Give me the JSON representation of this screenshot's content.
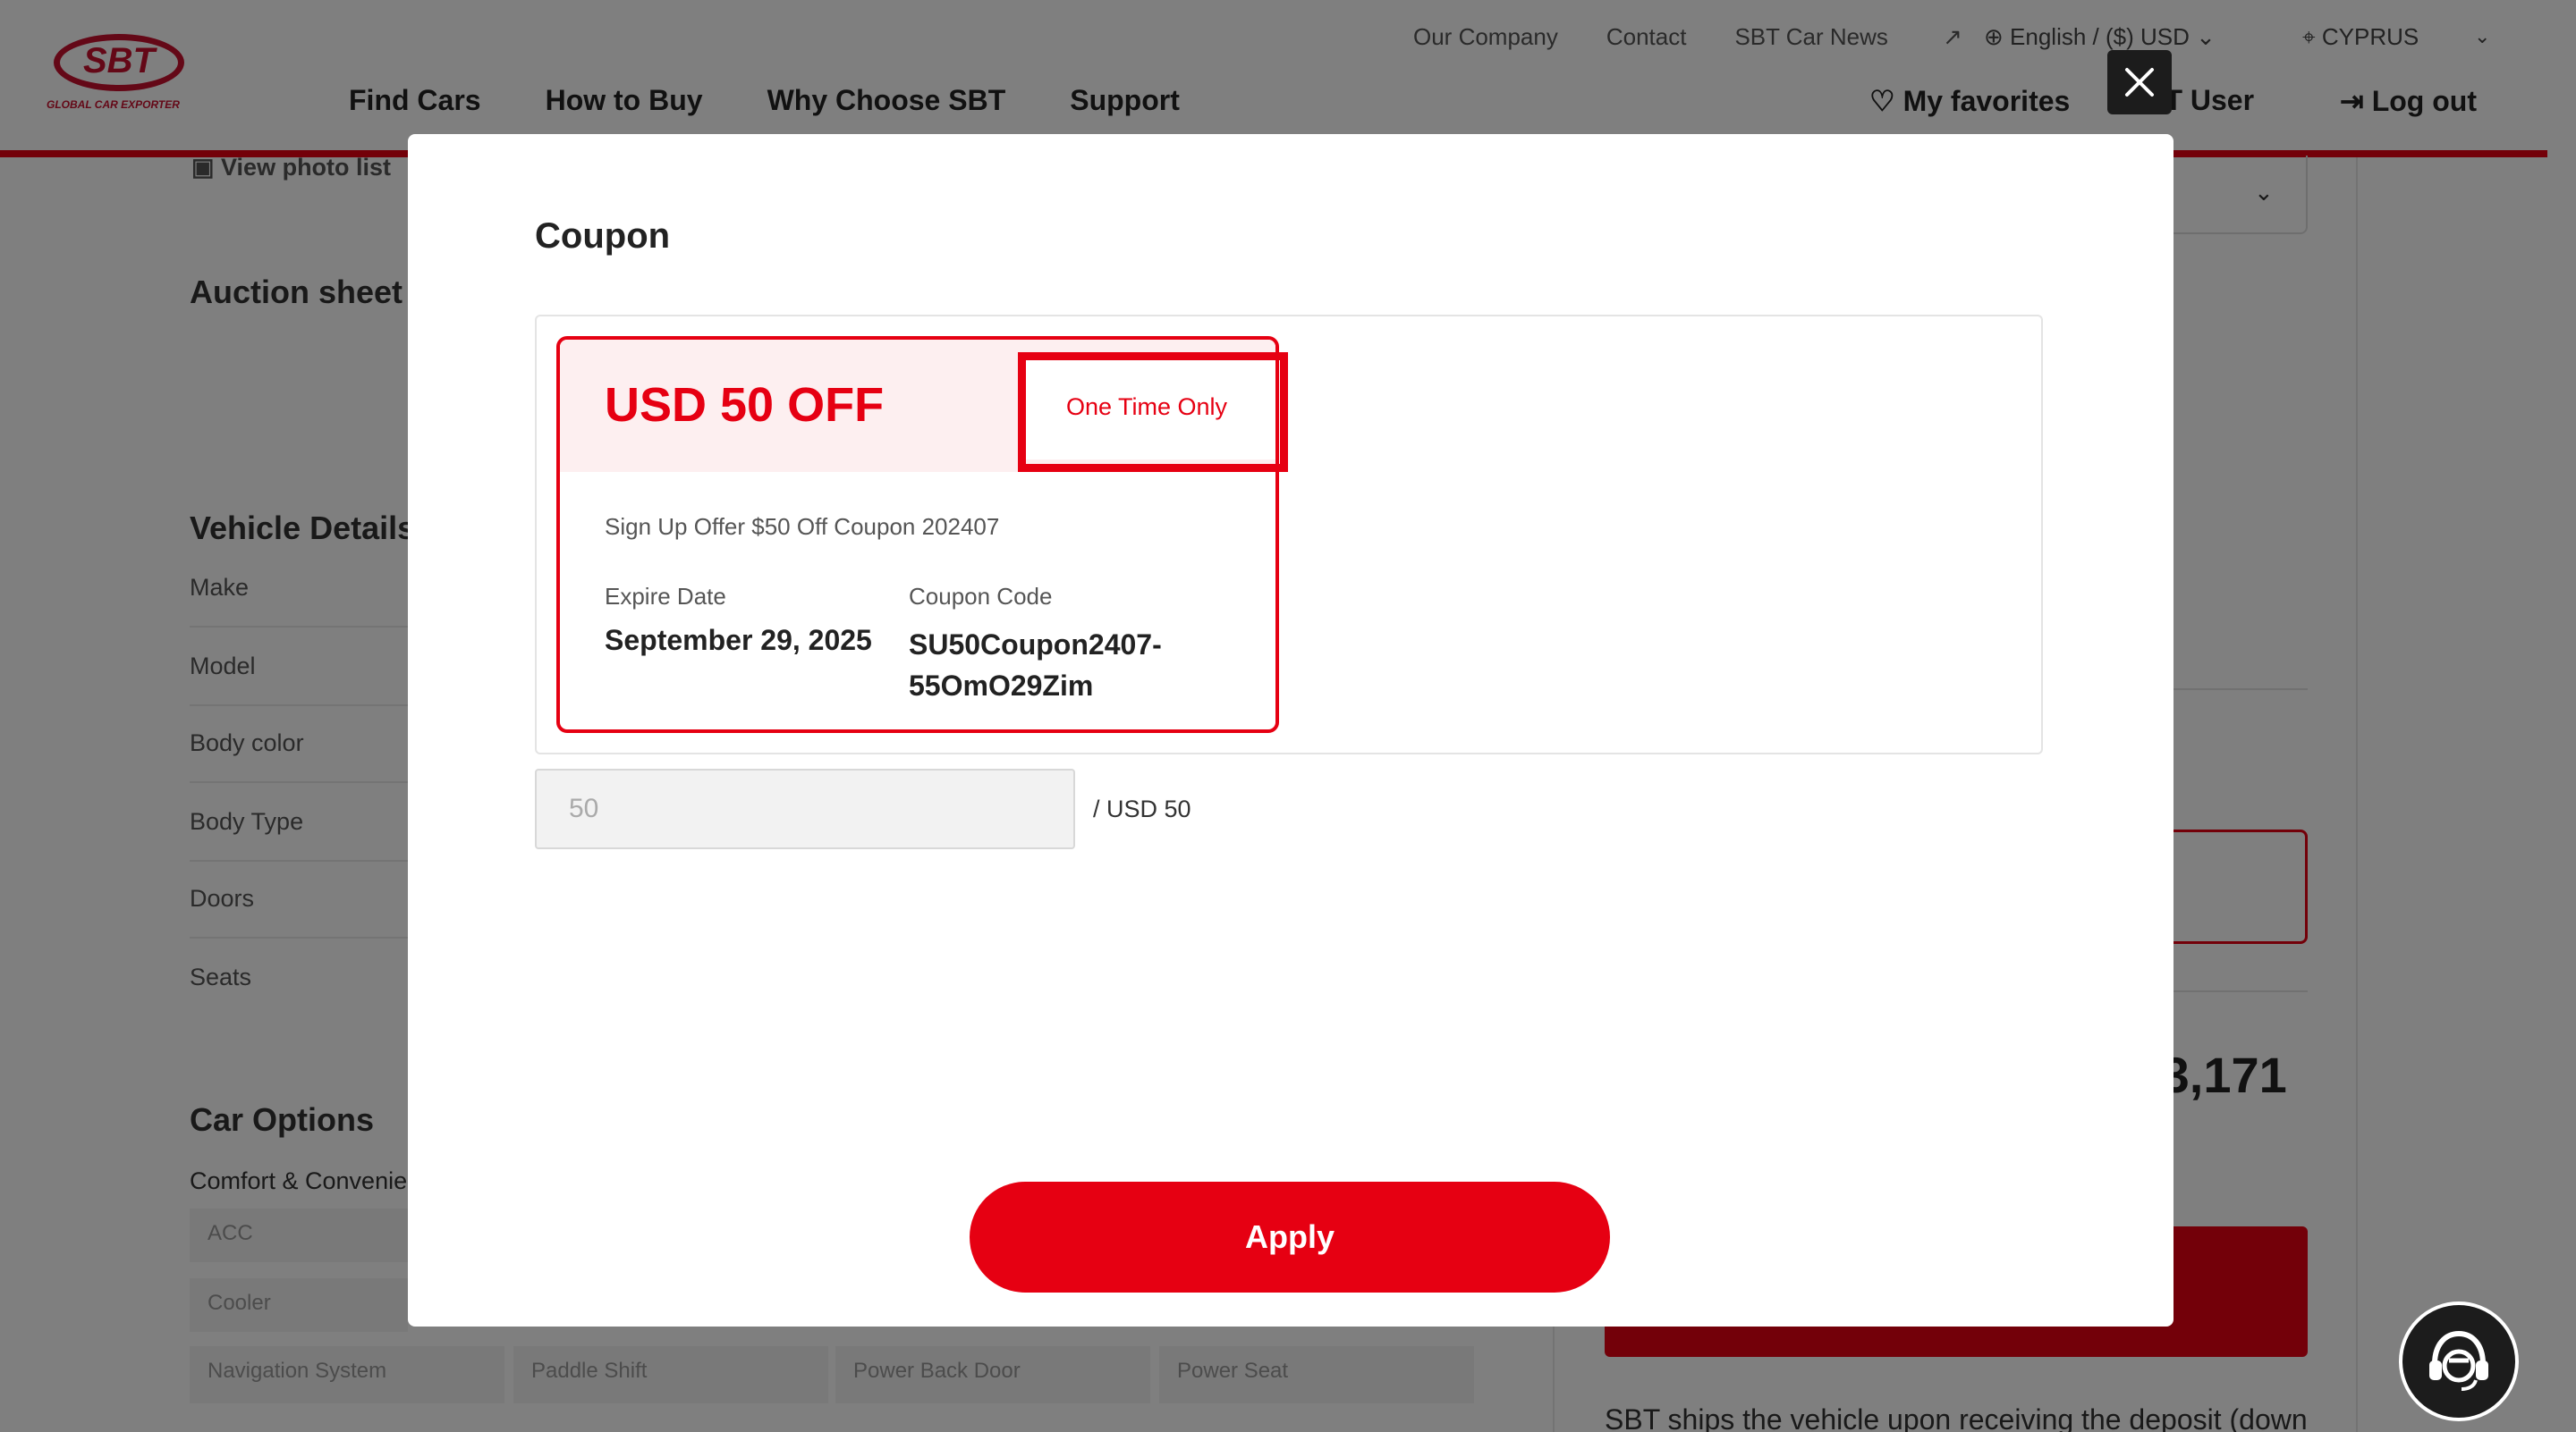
{
  "header": {
    "logo_text": "SBT",
    "logo_sub": "GLOBAL CAR EXPORTER",
    "util_nav": [
      "Our Company",
      "Contact",
      "SBT Car News"
    ],
    "language": "English / ($) USD",
    "country": "CYPRUS",
    "main_nav": [
      "Find Cars",
      "How to Buy",
      "Why Choose SBT",
      "Support"
    ],
    "favorites": "My favorites",
    "user": "SBT User",
    "logout": "Log out"
  },
  "background": {
    "view_photo_list": "View photo list",
    "auction_heading": "Auction sheet r",
    "vehicle_details_heading": "Vehicle Details",
    "vehicle_rows": [
      "Make",
      "Model",
      "Body color",
      "Body Type",
      "Doors",
      "Seats"
    ],
    "car_options_heading": "Car Options",
    "comfort_label": "Comfort & Convenie",
    "options": [
      "ACC",
      "Cooler",
      "Navigation System",
      "Paddle Shift",
      "Power Back Door",
      "Power Seat"
    ],
    "price_fragment": ")3,171",
    "shipping_text": "SBT ships the vehicle upon receiving the deposit (down"
  },
  "modal": {
    "title": "Coupon",
    "coupon": {
      "amount_label": "USD 50 OFF",
      "tag": "One Time Only",
      "description": "Sign Up Offer $50 Off Coupon 202407",
      "expire_label": "Expire Date",
      "expire_value": "September 29, 2025",
      "code_label": "Coupon Code",
      "code_value": "SU50Coupon2407-55OmO29Zim"
    },
    "amount_input_placeholder": "50",
    "amount_max": "/ USD 50",
    "apply_label": "Apply"
  },
  "colors": {
    "brand_red": "#e60012",
    "overlay": "rgba(0,0,0,0.5)"
  }
}
